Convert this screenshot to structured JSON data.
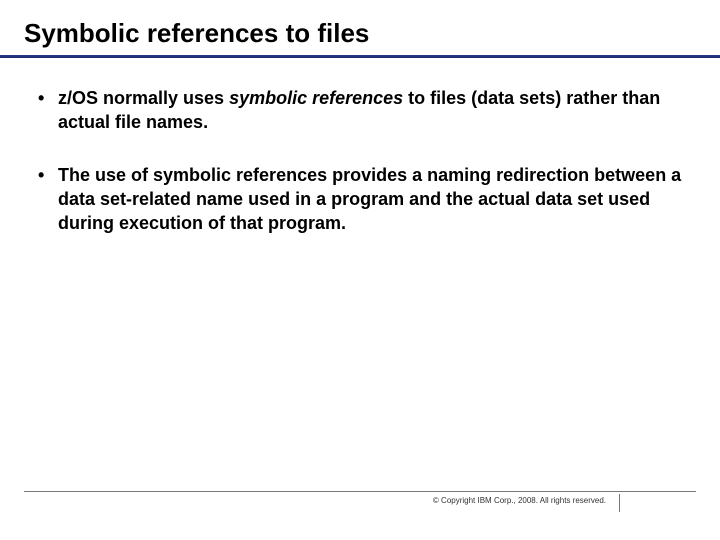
{
  "title": "Symbolic references to files",
  "bullets": [
    {
      "pre": "z/OS normally uses ",
      "em": "symbolic references",
      "post": " to files (data sets) rather than actual file names."
    },
    {
      "pre": "The use of symbolic references provides a naming redirection between a data set-related name used in a program and the actual data set used during execution of that program.",
      "em": "",
      "post": ""
    }
  ],
  "copyright": "© Copyright IBM Corp., 2008. All rights reserved."
}
